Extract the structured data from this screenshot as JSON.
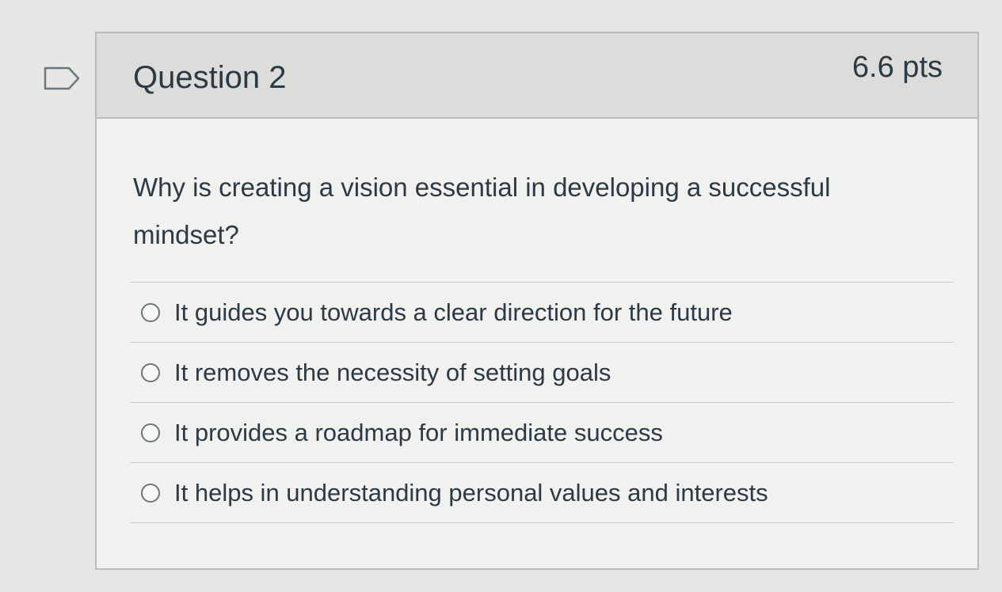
{
  "question": {
    "title": "Question 2",
    "points": "6.6 pts",
    "text": "Why is creating a vision essential in developing a successful mindset?",
    "flag_icon": "flag-question-icon",
    "answers": [
      {
        "label": "It guides you towards a clear direction for the future"
      },
      {
        "label": "It removes the necessity of setting goals"
      },
      {
        "label": "It provides a roadmap for immediate success"
      },
      {
        "label": "It helps in understanding personal values and interests"
      }
    ]
  },
  "colors": {
    "page_background": "#e7e7e5",
    "card_background": "#f1f1ef",
    "header_background": "#dcdcda",
    "border": "#b9bcbf",
    "text": "#2b3a44"
  }
}
